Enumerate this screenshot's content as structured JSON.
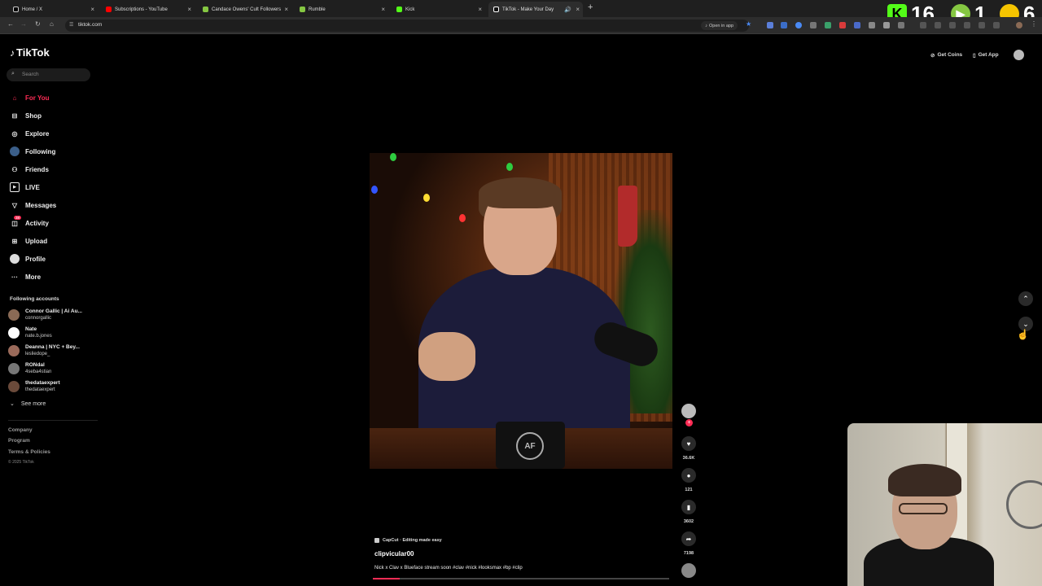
{
  "browser": {
    "tabs": [
      {
        "title": "Home / X",
        "color": "#ffffff"
      },
      {
        "title": "Subscriptions - YouTube",
        "color": "#ff0000"
      },
      {
        "title": "Candace Owens' Cult Followers",
        "color": "#85c742"
      },
      {
        "title": "Rumble",
        "color": "#85c742"
      },
      {
        "title": "Kick",
        "color": "#53fc18"
      },
      {
        "title": "TikTok - Make Your Day",
        "color": "#ffffff"
      }
    ],
    "url": "tiktok.com",
    "open_in_app": "Open in app"
  },
  "overlay": {
    "kick_count": "16",
    "rumble_count": "1",
    "third_count": "6"
  },
  "tiktok": {
    "logo": "TikTok",
    "search_placeholder": "Search",
    "nav": [
      {
        "label": "For You",
        "icon": "home-icon"
      },
      {
        "label": "Shop",
        "icon": "shop-icon"
      },
      {
        "label": "Explore",
        "icon": "compass-icon"
      },
      {
        "label": "Following",
        "icon": "following-avatar-icon"
      },
      {
        "label": "Friends",
        "icon": "friends-icon"
      },
      {
        "label": "LIVE",
        "icon": "live-icon"
      },
      {
        "label": "Messages",
        "icon": "messages-icon"
      },
      {
        "label": "Activity",
        "icon": "activity-icon"
      },
      {
        "label": "Upload",
        "icon": "upload-icon"
      },
      {
        "label": "Profile",
        "icon": "profile-icon"
      },
      {
        "label": "More",
        "icon": "more-icon"
      }
    ],
    "activity_badge": "38",
    "following_accounts_title": "Following accounts",
    "accounts": [
      {
        "name": "Connor Gallic | Ai Au...",
        "handle": "connorgallic",
        "color": "#8a6a55"
      },
      {
        "name": "Nate",
        "handle": "nate.b.jones",
        "color": "#ffffff"
      },
      {
        "name": "Deanna | NYC + Bey...",
        "handle": "lesliedope_",
        "color": "#9a6a5a"
      },
      {
        "name": "RONdal",
        "handle": "4seba4stian",
        "color": "#777777"
      },
      {
        "name": "thedataexpert",
        "handle": "thedataexpert",
        "color": "#6a4a3a"
      }
    ],
    "see_more": "See more",
    "footer": {
      "company": "Company",
      "program": "Program",
      "terms": "Terms & Policies",
      "copyright": "© 2025 TikTok"
    },
    "get_coins": "Get Coins",
    "get_app": "Get App",
    "video": {
      "mug_logo": "AF",
      "capcut": "CapCut · Editing made easy",
      "author": "clipvicular00",
      "description": "Nick x Clav x Blueface stream soon #clav #nick #looksmax #bp #clip",
      "likes": "36.6K",
      "comments": "121",
      "saves": "3602",
      "shares": "7198",
      "progress": 0.09
    }
  },
  "colors": {
    "accent": "#fe2c55",
    "kick_green": "#53fc18",
    "rumble_green": "#85c742",
    "yellow": "#f5c400"
  }
}
